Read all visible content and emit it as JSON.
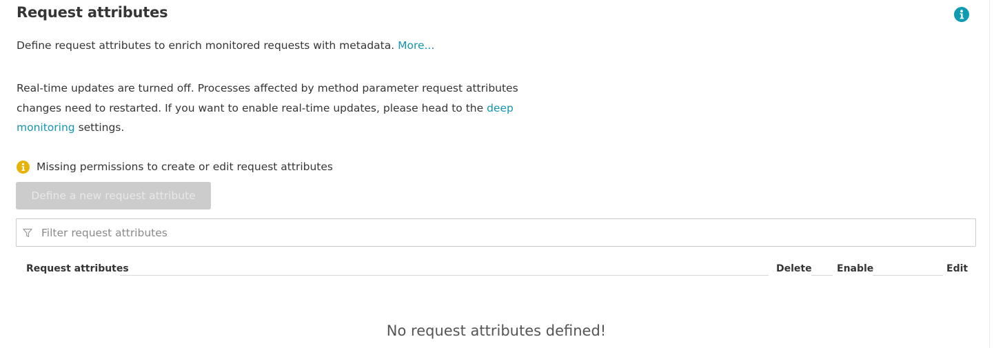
{
  "header": {
    "title": "Request attributes",
    "info_icon": "info-icon"
  },
  "description": {
    "text": "Define request attributes to enrich monitored requests with metadata.",
    "more_link": "More..."
  },
  "realtime_note": {
    "text_before": "Real-time updates are turned off. Processes affected by method parameter request attributes changes need to restarted. If you want to enable real-time updates, please head to the",
    "link": "deep monitoring",
    "text_after": "settings."
  },
  "warning": {
    "icon": "warning-info-icon",
    "text": "Missing permissions to create or edit request attributes"
  },
  "define_button": {
    "label": "Define a new request attribute",
    "disabled": true
  },
  "filter": {
    "icon": "filter-icon",
    "placeholder": "Filter request attributes",
    "value": ""
  },
  "table": {
    "columns": {
      "name": "Request attributes",
      "delete": "Delete",
      "enable": "Enable",
      "edit": "Edit"
    },
    "rows": [],
    "empty_message": "No request attributes defined!"
  },
  "colors": {
    "accent": "#1496ad",
    "info_icon": "#0f9bb0",
    "warning_icon": "#e7b30b",
    "disabled_button": "#cccccc",
    "text": "#353535"
  }
}
